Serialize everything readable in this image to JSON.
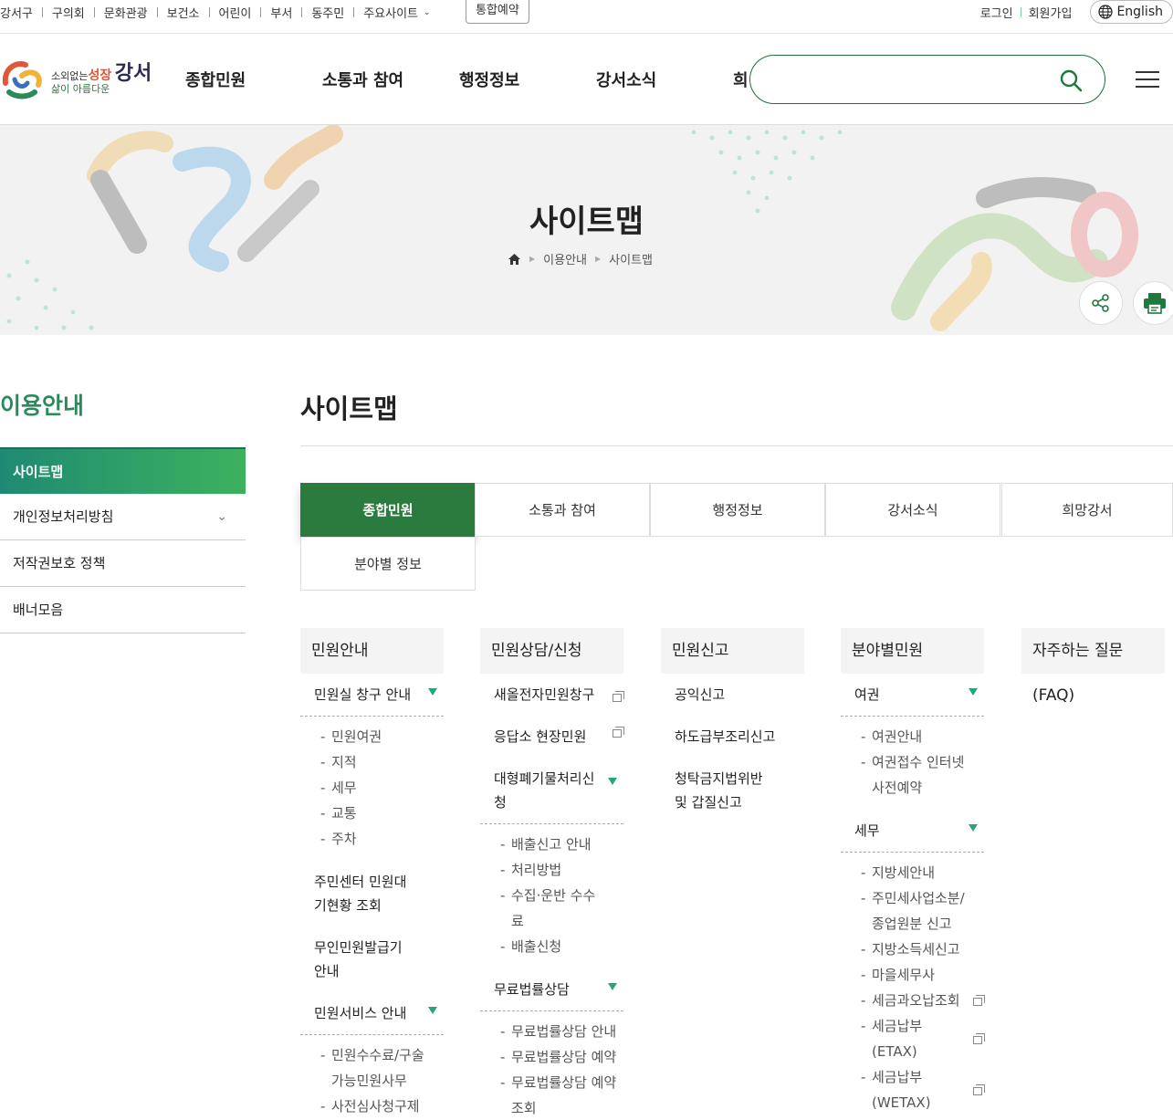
{
  "util": {
    "links": [
      "강서구",
      "구의회",
      "문화관광",
      "보건소",
      "어린이",
      "부서",
      "동주민",
      "주요사이트"
    ],
    "reserve": "통합예약",
    "login": "로그인",
    "join": "회원가입",
    "english": "English"
  },
  "header": {
    "logo": {
      "line1a": "소외",
      "line1b": "없는",
      "line1c": "성장",
      "line2": "삶이 아름다운",
      "big": "강서"
    },
    "gnb": [
      "종합민원",
      "소통과 참여",
      "행정정보",
      "강서소식",
      "희"
    ]
  },
  "visual": {
    "title": "사이트맵",
    "breadcrumb": [
      "이용안내",
      "사이트맵"
    ]
  },
  "lnb": {
    "title": "이용안내",
    "items": [
      "사이트맵",
      "개인정보처리방침",
      "저작권보호 정책",
      "배너모음"
    ]
  },
  "content": {
    "title": "사이트맵",
    "tabs": [
      "종합민원",
      "소통과 참여",
      "행정정보",
      "강서소식",
      "희망강서",
      "분야별 정보"
    ],
    "cols": {
      "c1": {
        "head": "민원안내",
        "g1": "민원실 창구 안내",
        "g1_items": [
          "민원여권",
          "지적",
          "세무",
          "교통",
          "주차"
        ],
        "l2": "주민센터 민원대기현황 조회",
        "l3": "무인민원발급기 안내",
        "g2": "민원서비스 안내",
        "g2_items": [
          "민원수수료/구술가능민원사무",
          "사전심사청구제"
        ]
      },
      "c2": {
        "head": "민원상담/신청",
        "l1": "새올전자민원창구",
        "l2": "응답소 현장민원",
        "g1": "대형폐기물처리신청",
        "g1_items": [
          "배출신고 안내",
          "처리방법",
          "수집·운반 수수료",
          "배출신청"
        ],
        "g2": "무료법률상담",
        "g2_items": [
          "무료법률상담 안내",
          "무료법률상담 예약",
          "무료법률상담 예약조회"
        ]
      },
      "c3": {
        "head": "민원신고",
        "l1": "공익신고",
        "l2": "하도급부조리신고",
        "l3": "청탁금지법위반 및 갑질신고"
      },
      "c4": {
        "head": "분야별민원",
        "g1": "여권",
        "g1_items": [
          "여권안내",
          "여권접수 인터넷 사전예약"
        ],
        "g2": "세무",
        "g2_items": [
          "지방세안내",
          "주민세사업소분/종업원분 신고",
          "지방소득세신고",
          "마을세무사",
          "세금과오납조회",
          "세금납부(ETAX)",
          "세금납부(WETAX)"
        ]
      },
      "c5": {
        "head": "자주하는 질문",
        "l1": "(FAQ)"
      }
    }
  },
  "colors": {
    "green": "#2b7a3e",
    "teal": "#2a8a5a",
    "accent": "#2aa37a"
  }
}
